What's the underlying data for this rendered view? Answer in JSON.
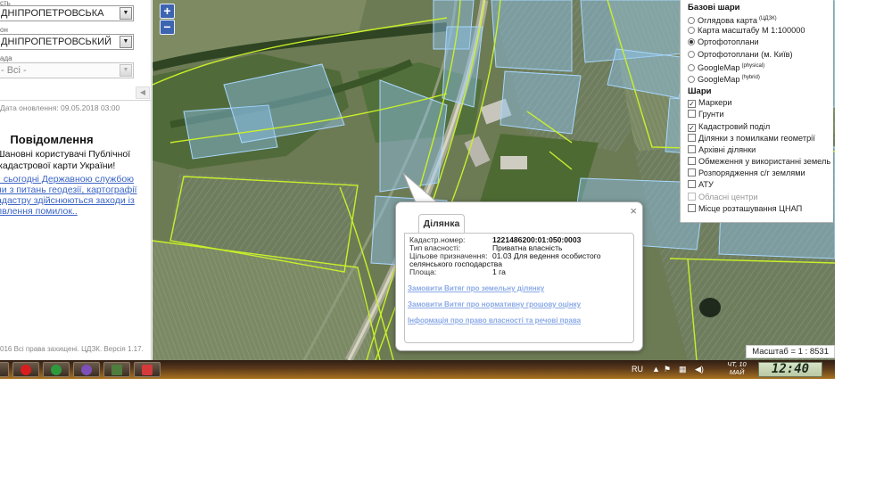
{
  "left_panel": {
    "selects": [
      {
        "label": "сть",
        "value": "ДНІПРОПЕТРОВСЬКА"
      },
      {
        "label": "он",
        "value": "ДНІПРОПЕТРОВСЬКИЙ"
      },
      {
        "label": "ада",
        "value": "- Всі -"
      }
    ],
    "update_date": "Дата оновлення: 09.05.2018 03:00",
    "notification_title": "Повідомлення",
    "notification_lines": [
      "Шановні користувачі Публічної",
      "кадастрової карти України!"
    ],
    "notification_links": [
      ". сьогодні Державною службою",
      "ни з питань геодезії, картографії",
      "адастру здійснюються заходи із",
      "лвлення помилок.."
    ],
    "copyright": "016 Всі права захищені. ЦДЗК. Версія 1.17."
  },
  "map": {
    "zoom_in": "+",
    "zoom_out": "−",
    "scale_text": "Масштаб = 1 : 8531"
  },
  "layers_panel": {
    "base_title": "Базові шари",
    "base_layers": [
      {
        "label": "Оглядова карта",
        "sup": "(ЦДЗК)",
        "selected": false
      },
      {
        "label": "Карта масштабу М 1:100000",
        "sup": "",
        "selected": false
      },
      {
        "label": "Ортофотоплани",
        "sup": "",
        "selected": true
      },
      {
        "label": "Ортофотоплани (м. Київ)",
        "sup": "",
        "selected": false
      },
      {
        "label": "GoogleMap",
        "sup": "(physical)",
        "selected": false
      },
      {
        "label": "GoogleMap",
        "sup": "(hybrid)",
        "selected": false
      }
    ],
    "layers_title": "Шари",
    "layers": [
      {
        "label": "Маркери",
        "checked": true,
        "disabled": false
      },
      {
        "label": "Грунти",
        "checked": false,
        "disabled": false
      },
      {
        "label": "Кадастровий поділ",
        "checked": true,
        "disabled": false
      },
      {
        "label": "Ділянки з помилками геометрії",
        "checked": false,
        "disabled": false
      },
      {
        "label": "Архівні ділянки",
        "checked": false,
        "disabled": false
      },
      {
        "label": "Обмеження у використанні земель",
        "checked": false,
        "disabled": false
      },
      {
        "label": "Розпорядження с/г землями",
        "checked": false,
        "disabled": false
      },
      {
        "label": "АТУ",
        "checked": false,
        "disabled": false
      },
      {
        "label": "Обласні центри",
        "checked": false,
        "disabled": true
      },
      {
        "label": "Місце розташування ЦНАП",
        "checked": false,
        "disabled": false
      }
    ]
  },
  "popup": {
    "tab_label": "Ділянка",
    "close": "×",
    "fields": [
      {
        "key": "Кадастр.номер:",
        "value": "1221486200:01:050:0003"
      },
      {
        "key": "Тип власності:",
        "value": "Приватна власність"
      },
      {
        "key": "Цільове призначення:",
        "value": "01.03 Для ведення особистого"
      },
      {
        "key": "",
        "value": "селянського господарства"
      },
      {
        "key": "Площа:",
        "value": "1 га"
      }
    ],
    "links": [
      "Замовити Витяг про земельну ділянку",
      "Замовити Витяг про нормативну грошову оцінку",
      "Інформація про право власності та речові права"
    ]
  },
  "taskbar": {
    "language": "RU",
    "day": "ЧТ, 10",
    "month": "МАЙ",
    "time": "12:40",
    "apps": [
      "opera-icon",
      "chrome-icon",
      "viber-icon",
      "explorer-icon",
      "camera-icon"
    ],
    "colors": {
      "opera": "#d81e1e",
      "chrome": "#2e9a3e",
      "viber": "#7d4fb8",
      "explorer": "#4f7d3d",
      "camera": "#d43a3a"
    }
  }
}
